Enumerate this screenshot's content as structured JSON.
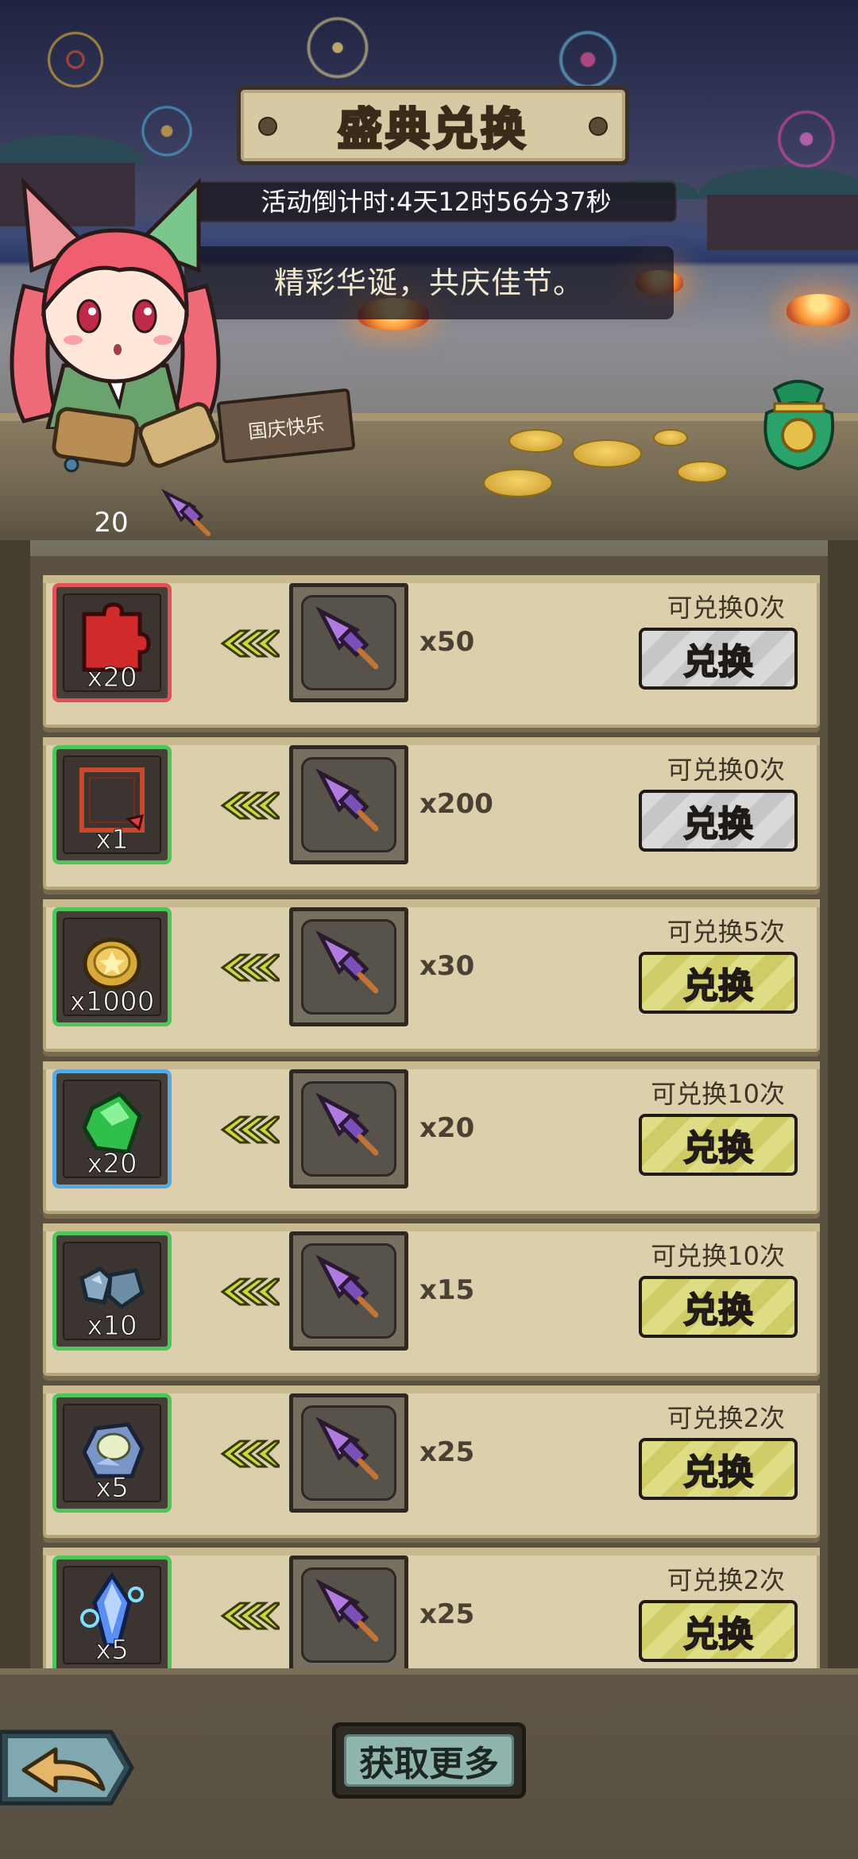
{
  "header": {
    "title": "盛典兑换",
    "countdown": "活动倒计时:4天12时56分37秒",
    "slogan": "精彩华诞，共庆佳节。",
    "sign_text": "国庆快乐"
  },
  "currency": {
    "icon": "firework-rocket-icon",
    "count": "20"
  },
  "rows": [
    {
      "item_icon": "red-puzzle-piece-icon",
      "item_qty": "x20",
      "frame_color": "#e05258",
      "cost_qty": "x50",
      "remaining": "可兑换0次",
      "button": "兑换",
      "enabled": false
    },
    {
      "item_icon": "red-picture-frame-icon",
      "item_qty": "x1",
      "frame_color": "#4fc45a",
      "cost_qty": "x200",
      "remaining": "可兑换0次",
      "button": "兑换",
      "enabled": false
    },
    {
      "item_icon": "gold-coin-icon",
      "item_qty": "x1000",
      "frame_color": "#4fc45a",
      "cost_qty": "x30",
      "remaining": "可兑换5次",
      "button": "兑换",
      "enabled": true
    },
    {
      "item_icon": "green-gem-icon",
      "item_qty": "x20",
      "frame_color": "#5aa8e0",
      "cost_qty": "x20",
      "remaining": "可兑换10次",
      "button": "兑换",
      "enabled": true
    },
    {
      "item_icon": "blue-ore-icon",
      "item_qty": "x10",
      "frame_color": "#4fc45a",
      "cost_qty": "x15",
      "remaining": "可兑换10次",
      "button": "兑换",
      "enabled": true
    },
    {
      "item_icon": "crystal-ore-icon",
      "item_qty": "x5",
      "frame_color": "#4fc45a",
      "cost_qty": "x25",
      "remaining": "可兑换2次",
      "button": "兑换",
      "enabled": true
    },
    {
      "item_icon": "blue-crystal-icon",
      "item_qty": "x5",
      "frame_color": "#4fc45a",
      "cost_qty": "x25",
      "remaining": "可兑换2次",
      "button": "兑换",
      "enabled": true
    }
  ],
  "footer": {
    "more_button": "获取更多",
    "back_icon": "back-arrow-icon"
  }
}
